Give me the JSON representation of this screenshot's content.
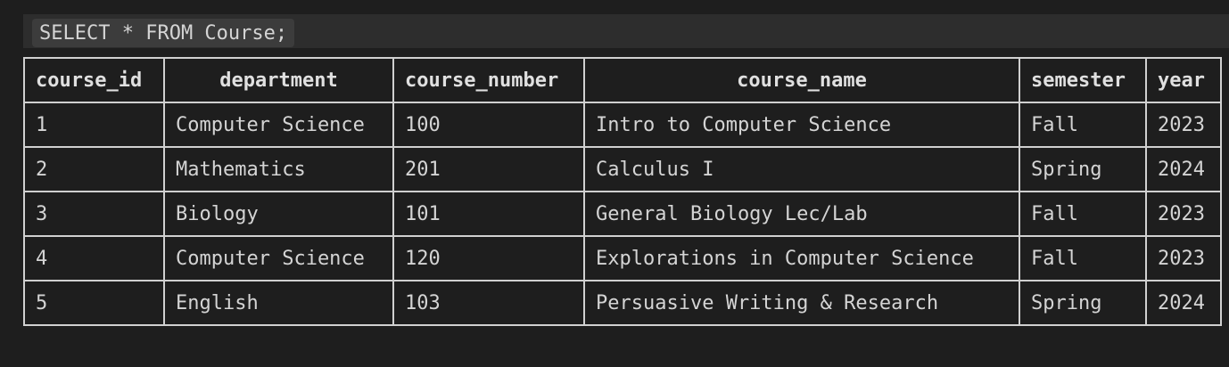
{
  "query": {
    "text": "SELECT * FROM Course;"
  },
  "table": {
    "headers": [
      "course_id",
      "department",
      "course_number",
      "course_name",
      "semester",
      "year"
    ],
    "rows": [
      [
        "1",
        "Computer Science",
        "100",
        "Intro to Computer Science",
        "Fall",
        "2023"
      ],
      [
        "2",
        "Mathematics",
        "201",
        "Calculus I",
        "Spring",
        "2024"
      ],
      [
        "3",
        "Biology",
        "101",
        "General Biology Lec/Lab",
        "Fall",
        "2023"
      ],
      [
        "4",
        "Computer Science",
        "120",
        "Explorations in Computer Science",
        "Fall",
        "2023"
      ],
      [
        "5",
        "English",
        "103",
        "Persuasive Writing & Research",
        "Spring",
        "2024"
      ]
    ]
  }
}
